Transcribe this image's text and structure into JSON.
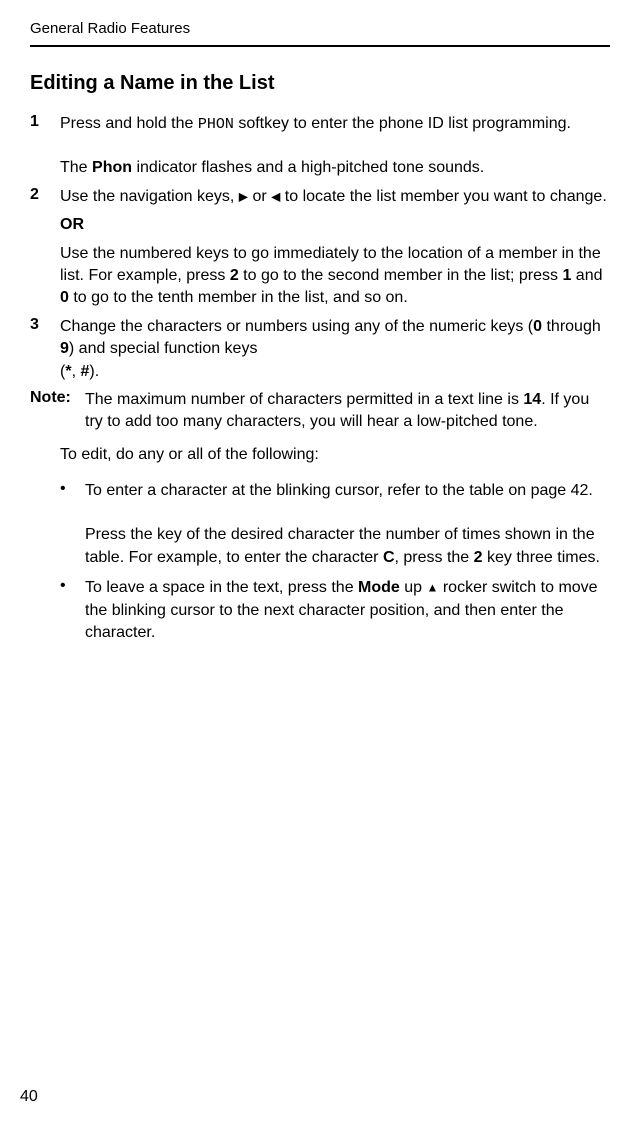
{
  "header": "General Radio Features",
  "title": "Editing a Name in the List",
  "step1": {
    "num": "1",
    "part1": "Press and hold the ",
    "softkey": "PHON",
    "part2": " softkey to enter the phone ID list programming.",
    "followup1": "The ",
    "followupBold": "Phon",
    "followup2": " indicator flashes and a high-pitched tone sounds."
  },
  "step2": {
    "num": "2",
    "part1": "Use the navigation keys,  ",
    "arrowR": "▶",
    "part2": " or ",
    "arrowL": "◀",
    "part3": "  to locate the list member you want to change.",
    "or": "OR",
    "alt1": "Use the numbered keys to go immediately to the location of a member in the list. For example, press ",
    "key2": "2",
    "alt2": " to go to the second member in the list; press ",
    "key1": "1",
    "alt3": " and ",
    "key0": "0",
    "alt4": " to go to the tenth member in the list, and so on."
  },
  "step3": {
    "num": "3",
    "part1": "Change the characters or numbers using any of the numeric keys (",
    "key0": "0",
    "part2": " through ",
    "key9": "9",
    "part3": ") and special function keys",
    "part4": "(",
    "star": "*",
    "part5": ", ",
    "hash": "#",
    "part6": ")."
  },
  "note": {
    "label": "Note:",
    "part1": "The maximum number of characters permitted in a text line is ",
    "num": "14",
    "part2": ". If you try to add too many characters, you will hear a low-pitched tone."
  },
  "editIntro": "To edit, do any or all of the following:",
  "bullet1": {
    "part1": "To enter a character at the blinking cursor, refer to the table on page 42.",
    "part2a": "Press the key of the desired character the number of times shown in the table. For example, to enter the character ",
    "keyC": "C",
    "part2b": ", press the ",
    "key2": "2",
    "part2c": " key three times."
  },
  "bullet2": {
    "part1": "To leave a space in the text, press the ",
    "mode": "Mode",
    "part2": " up ",
    "arrow": "▲",
    "part3": " rocker switch to move the blinking cursor to the next character position, and then enter the character."
  },
  "pageNum": "40"
}
